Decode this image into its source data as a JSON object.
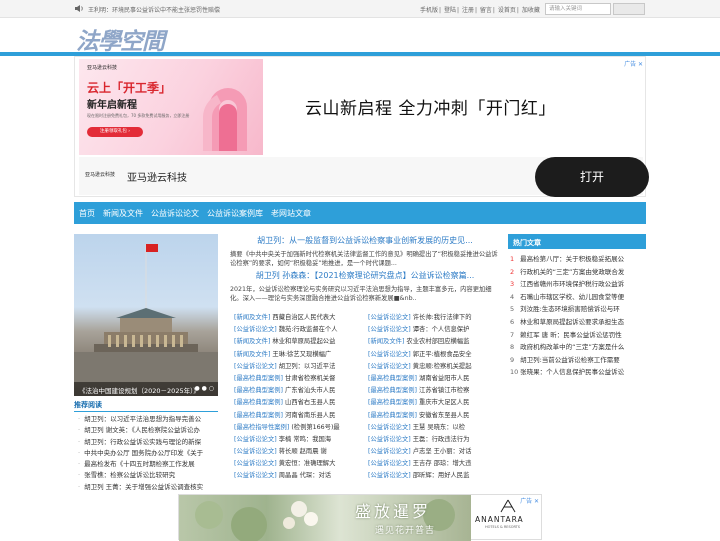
{
  "topbar": {
    "announcement": "王利明：环境民事公益诉讼中不能主张惩罚性赔偿",
    "links": [
      "手机版",
      "登陆",
      "注册",
      "留言",
      "设首页",
      "加收藏"
    ],
    "search_placeholder": "请输入关键词"
  },
  "logo": "法學空間",
  "ad_top": {
    "ad_flag": "广告 ✕",
    "brand": "亚马逊云科技",
    "headline_img": "云上「开工季」",
    "subheadline_img": "新年启新程",
    "desc_img": "现在限时注册免费礼包，70 多款免费试用服务，立即注册",
    "button_img": "注册领取礼包 ›",
    "headline": "云山新启程 全力冲刺「开门红」",
    "brand_small": "亚马逊云科技",
    "brand_name": "亚马逊云科技",
    "cta": "打开"
  },
  "nav": [
    "首页",
    "新闻及文件",
    "公益诉讼论文",
    "公益诉讼案例库",
    "老网站文章"
  ],
  "slideshow": {
    "caption": "《法治中国建设规划（2020－2025年）》",
    "dots": "● ● ○"
  },
  "recommended": {
    "title": "推荐阅读",
    "items": [
      "胡卫列：以习近平法治思想为指导完善公",
      "胡卫列 谢文英：《人民检察院公益诉讼办",
      "胡卫列：行政公益诉讼实践与理论的新探",
      "中共中央办公厅 国务院办公厅印发《关于",
      "最高检发布《十四五时期检察工作发展",
      "张雪樵：检察公益诉讼比较研究",
      "胡卫列 王菁：关于增强公益诉讼调查核实"
    ]
  },
  "main": {
    "headline1": "胡卫列：从一般监督到公益诉讼检察事业创新发展的历史见...",
    "summary1": "摘要《中共中央关于加强新时代检察机关法律监督工作的意见》明确提出了“积极稳妥推进公益诉讼检察”的要求，如何“积极稳妥”地推进，是一个时代课题...",
    "headline2": "胡卫列 孙森森：【2021检察理论研究盘点】公益诉讼检察篇...",
    "summary2": "2021年，公益诉讼检察理论与实务研究以习近平法治思想为指导，主题丰富多元，内容更加细化。深入——理论与实务深度融合推进公益诉讼检察新发展■&nb..",
    "rows": [
      [
        {
          "cat": "[新闻及文件]",
          "title": "西藏自治区人民代表大"
        },
        {
          "cat": "[公益诉讼论文]",
          "title": "许长帅:我行法律下的"
        }
      ],
      [
        {
          "cat": "[公益诉讼论文]",
          "title": "魏苑:行政监督在个人"
        },
        {
          "cat": "[公益诉讼论文]",
          "title": "谭杏：个人信息保护"
        }
      ],
      [
        {
          "cat": "[新闻及文件]",
          "title": "林业和草原局提起公益"
        },
        {
          "cat": "[新闻及文件]",
          "title": "农业农村部回应横幅监"
        }
      ],
      [
        {
          "cat": "[新闻及文件]",
          "title": "王琳:徐艺又现横幅广"
        },
        {
          "cat": "[公益诉讼论文]",
          "title": "郭正平:植根食品安全"
        }
      ],
      [
        {
          "cat": "[公益诉讼论文]",
          "title": "胡卫列：以习近平法"
        },
        {
          "cat": "[公益诉讼论文]",
          "title": "黄忠顺:检察机关提起"
        }
      ],
      [
        {
          "cat": "[最高检典型案例]",
          "title": "甘肃省检察机关督"
        },
        {
          "cat": "[最高检典型案例]",
          "title": "湖南省益阳市人民"
        }
      ],
      [
        {
          "cat": "[最高检典型案例]",
          "title": "广东省汕头市人民"
        },
        {
          "cat": "[最高检典型案例]",
          "title": "江苏省镇江市检察"
        }
      ],
      [
        {
          "cat": "[最高检典型案例]",
          "title": "山西省右玉县人民"
        },
        {
          "cat": "[最高检典型案例]",
          "title": "重庆市大足区人民"
        }
      ],
      [
        {
          "cat": "[最高检典型案例]",
          "title": "河南省南乐县人民"
        },
        {
          "cat": "[最高检典型案例]",
          "title": "安徽省东至县人民"
        }
      ],
      [
        {
          "cat": "[最高检指导性案例]",
          "title": "(检例第166号)最"
        },
        {
          "cat": "[公益诉讼论文]",
          "title": "王慧 吴晓东：以检"
        }
      ],
      [
        {
          "cat": "[公益诉讼论文]",
          "title": "李楠 常鸣：我国海"
        },
        {
          "cat": "[公益诉讼论文]",
          "title": "王磊：行政违法行为"
        }
      ],
      [
        {
          "cat": "[公益诉讼论文]",
          "title": "蒋长顺 赵雨晨 谢"
        },
        {
          "cat": "[公益诉讼论文]",
          "title": "卢志坚 王小丽：对话"
        }
      ],
      [
        {
          "cat": "[公益诉讼论文]",
          "title": "黄宏恒：准确理解大"
        },
        {
          "cat": "[公益诉讼论文]",
          "title": "王吉存 邵琼：增大违"
        }
      ],
      [
        {
          "cat": "[公益诉讼论文]",
          "title": "周晶晶 代琛：对话"
        },
        {
          "cat": "[公益诉讼论文]",
          "title": "邵昕辉：用好人民监"
        }
      ]
    ]
  },
  "hot": {
    "title": "热门文章",
    "items": [
      {
        "n": "1",
        "text": "最高检第八厅：关于积极稳妥拓展公"
      },
      {
        "n": "2",
        "text": "行政机关的“三定”方案由党政联合发"
      },
      {
        "n": "3",
        "text": "江西省赣州市环境保护税行政公益诉"
      },
      {
        "n": "4",
        "text": "石嘴山市辖区学校、幼儿园食堂等便"
      },
      {
        "n": "5",
        "text": "刘汝胜:生态环境损害赔偿诉讼与环"
      },
      {
        "n": "6",
        "text": "林业和草原局提起诉讼要求承担生态"
      },
      {
        "n": "7",
        "text": "赖红军 唐 昕：民事公益诉讼惩罚性"
      },
      {
        "n": "8",
        "text": "政府机构改革中的“三定”方案是什么"
      },
      {
        "n": "9",
        "text": "胡卫列:当前公益诉讼检察工作需要"
      },
      {
        "n": "10",
        "text": "张晓果：个人信息保护民事公益诉讼"
      }
    ]
  },
  "ad_bottom": {
    "headline": "盛放暹罗",
    "sub": "遇见花开普吉",
    "brand": "ANANTARA",
    "brand_sub": "HOTELS & RESORTS",
    "ad_flag": "广告 ✕"
  }
}
